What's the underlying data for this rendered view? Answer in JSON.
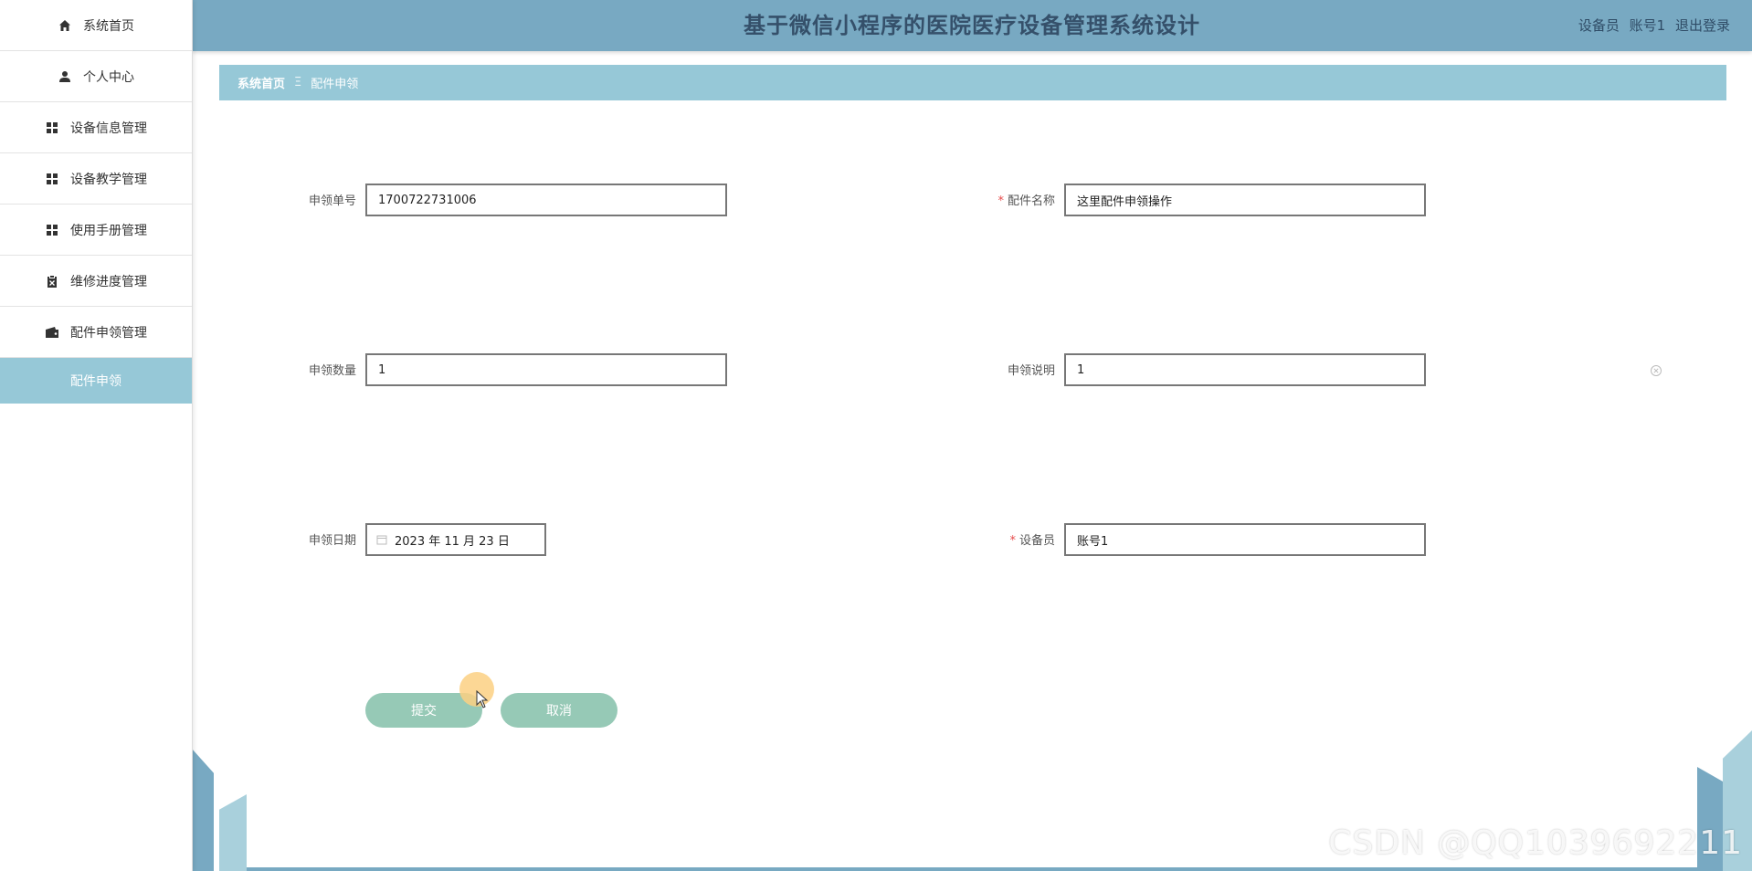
{
  "header": {
    "title": "基于微信小程序的医院医疗设备管理系统设计",
    "role": "设备员",
    "account": "账号1",
    "logout": "退出登录"
  },
  "sidebar": {
    "items": [
      {
        "label": "系统首页",
        "icon": "home-icon"
      },
      {
        "label": "个人中心",
        "icon": "user-icon"
      },
      {
        "label": "设备信息管理",
        "icon": "grid-icon"
      },
      {
        "label": "设备教学管理",
        "icon": "grid-icon"
      },
      {
        "label": "使用手册管理",
        "icon": "grid-icon"
      },
      {
        "label": "维修进度管理",
        "icon": "clipboard-icon"
      },
      {
        "label": "配件申领管理",
        "icon": "wallet-icon"
      }
    ],
    "sub_item": "配件申领"
  },
  "breadcrumb": {
    "home": "系统首页",
    "separator": "Ξ",
    "current": "配件申领"
  },
  "form": {
    "order_no": {
      "label": "申领单号",
      "value": "1700722731006"
    },
    "part_name": {
      "label": "配件名称",
      "value": "这里配件申领操作",
      "required": true
    },
    "quantity": {
      "label": "申领数量",
      "value": "1"
    },
    "description": {
      "label": "申领说明",
      "value": "1"
    },
    "date": {
      "label": "申领日期",
      "value": "2023 年 11 月 23 日"
    },
    "operator": {
      "label": "设备员",
      "value": "账号1",
      "required": true
    },
    "required_mark": "*"
  },
  "buttons": {
    "submit": "提交",
    "cancel": "取消"
  },
  "watermark": "CSDN @QQ1039692211",
  "colors": {
    "header": "#78a9c2",
    "breadcrumb": "#96c8d7",
    "button": "#96c9b6"
  }
}
